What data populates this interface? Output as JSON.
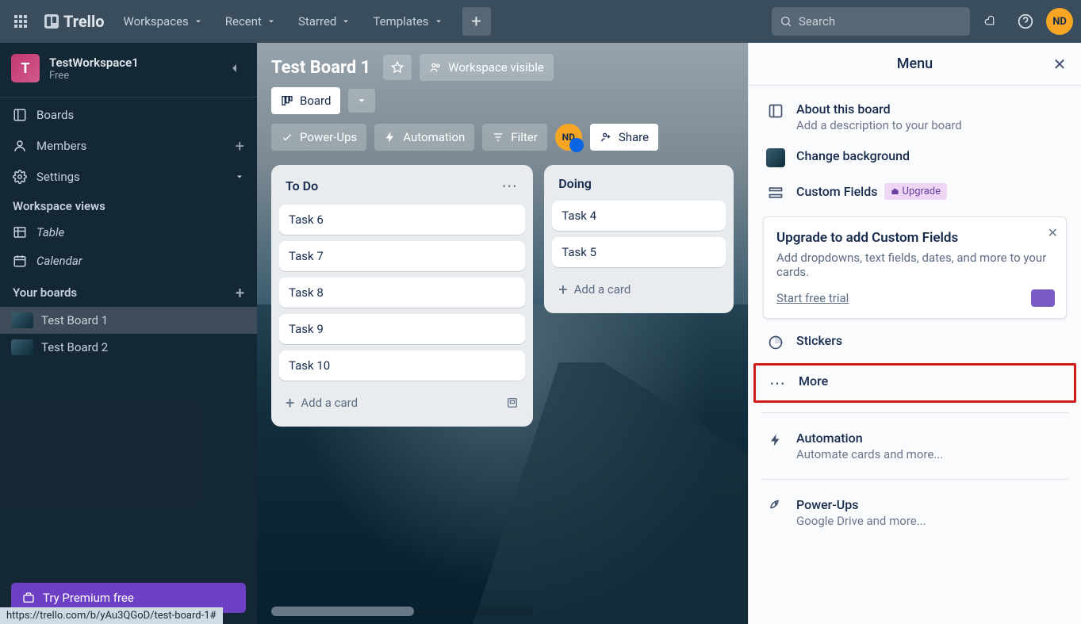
{
  "header": {
    "logo_text": "Trello",
    "nav": {
      "workspaces": "Workspaces",
      "recent": "Recent",
      "starred": "Starred",
      "templates": "Templates"
    },
    "search_placeholder": "Search",
    "avatar_initials": "ND"
  },
  "sidebar": {
    "workspace_badge": "T",
    "workspace_name": "TestWorkspace1",
    "workspace_plan": "Free",
    "items": {
      "boards": "Boards",
      "members": "Members",
      "settings": "Settings"
    },
    "views_header": "Workspace views",
    "views": {
      "table": "Table",
      "calendar": "Calendar"
    },
    "your_boards_header": "Your boards",
    "boards": [
      "Test Board 1",
      "Test Board 2"
    ],
    "premium_cta": "Try Premium free",
    "status_url": "https://trello.com/b/yAu3QGoD/test-board-1#"
  },
  "board": {
    "title": "Test Board 1",
    "visibility": "Workspace visible",
    "view_label": "Board",
    "buttons": {
      "powerups": "Power-Ups",
      "automation": "Automation",
      "filter": "Filter",
      "share": "Share"
    },
    "member_initials": "ND",
    "lists": [
      {
        "title": "To Do",
        "cards": [
          "Task 6",
          "Task 7",
          "Task 8",
          "Task 9",
          "Task 10"
        ],
        "add_label": "Add a card"
      },
      {
        "title": "Doing",
        "cards": [
          "Task 4",
          "Task 5"
        ],
        "add_label": "Add a card"
      }
    ]
  },
  "menu": {
    "title": "Menu",
    "about_title": "About this board",
    "about_sub": "Add a description to your board",
    "change_bg": "Change background",
    "custom_fields": "Custom Fields",
    "upgrade_badge": "Upgrade",
    "upgrade_box": {
      "title": "Upgrade to add Custom Fields",
      "text": "Add dropdowns, text fields, dates, and more to your cards.",
      "link": "Start free trial"
    },
    "stickers": "Stickers",
    "more": "More",
    "automation_title": "Automation",
    "automation_sub": "Automate cards and more...",
    "powerups_title": "Power-Ups",
    "powerups_sub": "Google Drive and more..."
  }
}
